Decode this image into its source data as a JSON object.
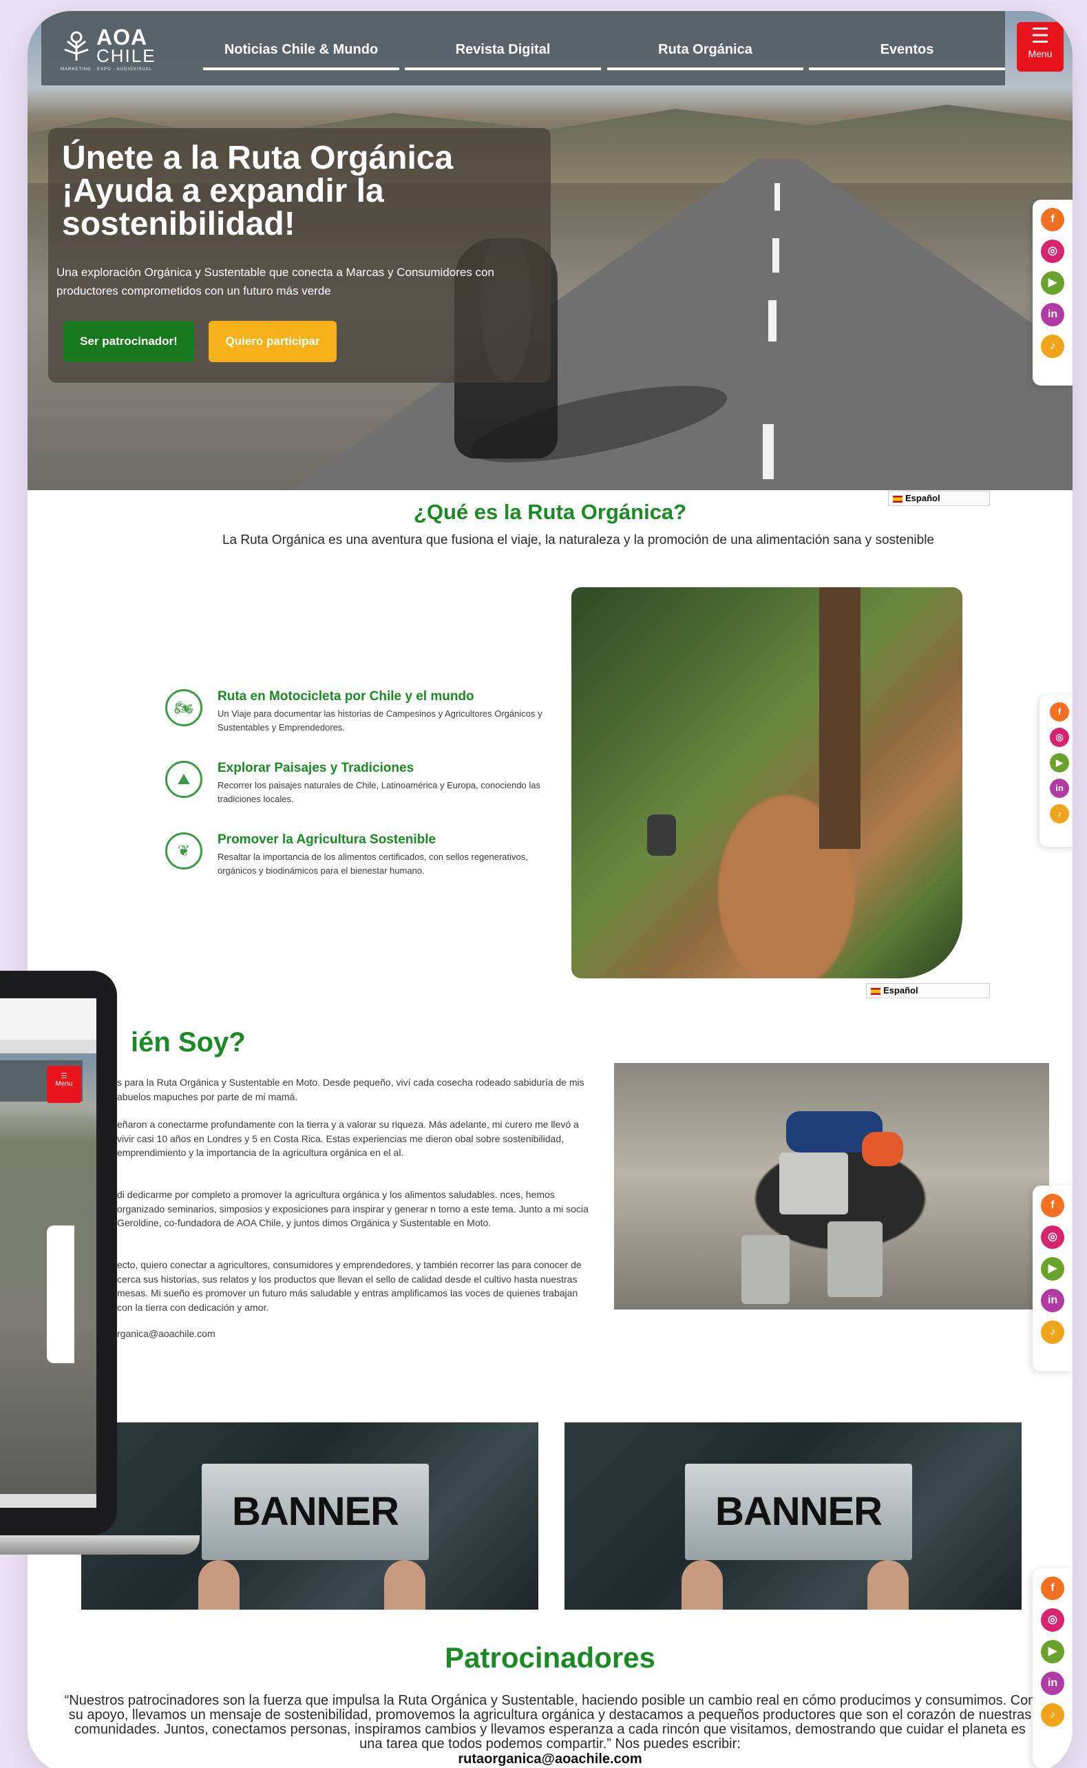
{
  "nav": {
    "logo_line1": "AOA",
    "logo_line2": "CHILE",
    "logo_tagline": "MARKETING · EXPO · AUDIOVISUAL",
    "items": [
      {
        "label": "Noticias Chile & Mundo"
      },
      {
        "label": "Revista Digital"
      },
      {
        "label": "Ruta Orgánica"
      },
      {
        "label": "Eventos"
      }
    ],
    "menu_icon": "hamburger-icon",
    "menu_label": "Menu"
  },
  "hero": {
    "title": "Únete a la Ruta Orgánica ¡Ayuda a expandir la sostenibilidad!",
    "subtitle": "Una exploración Orgánica y Sustentable que conecta a Marcas y Consumidores con productores comprometidos con un futuro más verde",
    "btn_sponsor": "Ser patrocinador!",
    "btn_join": "Quiero participar"
  },
  "social": {
    "icons": [
      "facebook-icon",
      "instagram-icon",
      "youtube-icon",
      "linkedin-icon",
      "tiktok-icon"
    ],
    "glyphs": [
      "f",
      "◎",
      "▶",
      "in",
      "♪"
    ],
    "colors": [
      "#f36f21",
      "#d6246e",
      "#6aa32b",
      "#b23aa5",
      "#f0a41b"
    ]
  },
  "language": {
    "label": "Español"
  },
  "que_es": {
    "title": "¿Qué es la Ruta Orgánica?",
    "intro": "La Ruta Orgánica es una aventura que fusiona el viaje, la naturaleza y la promoción de una alimentación sana y sostenible",
    "features": [
      {
        "icon": "motorcycle-icon",
        "title": "Ruta en Motocicleta por Chile y el mundo",
        "desc": "Un Viaje para documentar las historias de Campesinos y Agricultores Orgánicos y Sustentables y Emprendedores."
      },
      {
        "icon": "landscape-icon",
        "title": "Explorar Paisajes y Tradiciones",
        "desc": "Recorrer los paisajes naturales de Chile, Latinoamérica y Europa, conociendo las tradiciones locales."
      },
      {
        "icon": "sprout-icon",
        "title": "Promover la Agricultura Sostenible",
        "desc": "Resaltar la importancia de los alimentos certificados, con sellos regenerativos, orgánicos y biodinámicos para el bienestar humano."
      }
    ]
  },
  "quien_soy": {
    "title": "ién Soy?",
    "paragraphs": [
      "s para la Ruta Orgánica y Sustentable en Moto. Desde pequeño, viví cada cosecha rodeado sabiduría de mis abuelos mapuches por parte de mi mamá.",
      "eñaron a conectarme profundamente con la tierra y a valorar su riqueza. Más adelante, mi curero me llevó a vivir casi 10 años en Londres y 5 en Costa Rica. Estas experiencias me dieron obal sobre sostenibilidad, emprendimiento y la importancia de la agricultura orgánica en el al.",
      "di dedicarme por completo a promover la agricultura orgánica y los alimentos saludables. nces, hemos organizado seminarios, simposios y exposiciones para inspirar y generar n torno a este tema. Junto a mi socia Geroldine, co-fundadora de AOA Chile, y juntos dimos Orgánica y Sustentable en Moto.",
      "ecto, quiero conectar a agricultores, consumidores y emprendedores, y también recorrer las para conocer de cerca sus historias, sus relatos y los productos que llevan el sello de calidad desde el cultivo hasta nuestras mesas. Mi sueño es promover un futuro más saludable y entras amplificamos las voces de quienes trabajan con la tierra con dedicación y amor."
    ],
    "email": "rganica@aoachile.com"
  },
  "banners": [
    {
      "text": "BANNER"
    },
    {
      "text": "BANNER"
    }
  ],
  "sponsors": {
    "title": "Patrocinadores",
    "text": "“Nuestros patrocinadores son la fuerza que impulsa la Ruta Orgánica y Sustentable, haciendo posible un cambio real en cómo producimos y consumimos. Con su apoyo, llevamos un mensaje de sostenibilidad, promovemos la agricultura orgánica y destacamos a pequeños productores que son el corazón de nuestras comunidades. Juntos, conectamos personas, inspiramos cambios y llevamos esperanza a cada rincón que visitamos, demostrando que cuidar el planeta es una tarea que todos podemos compartir.” Nos puedes escribir:",
    "email": "rutaorganica@aoachile.com"
  },
  "laptop": {
    "menu_label": "Menu"
  },
  "colors": {
    "brand_green": "#1b8a25",
    "button_green": "#16791d",
    "button_yellow": "#f6b11a",
    "menu_red": "#e8141c",
    "nav_bg": "#525c64"
  }
}
